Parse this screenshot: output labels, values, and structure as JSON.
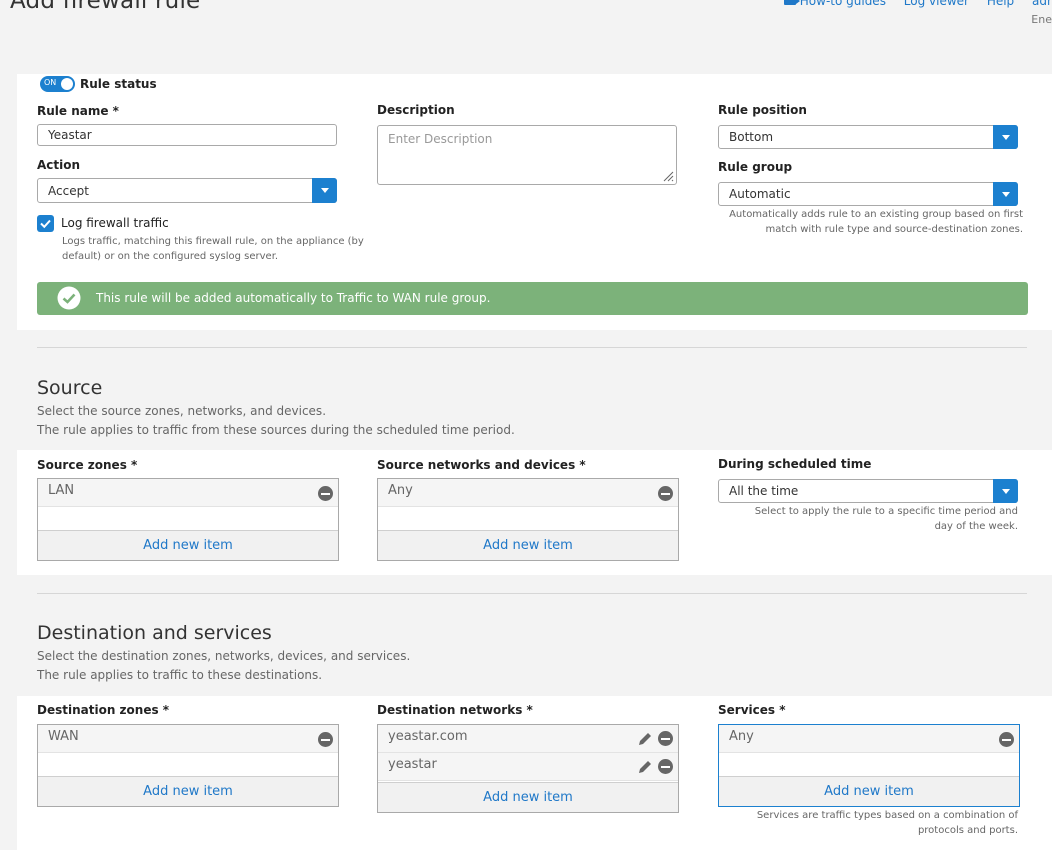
{
  "page": {
    "title": "Add firewall rule"
  },
  "top_links": {
    "howto": "How-to guides",
    "log_viewer": "Log viewer",
    "help": "Help",
    "admin": "admi",
    "admin_sub": "Ene"
  },
  "rule_status": {
    "toggle": "ON",
    "label": "Rule status"
  },
  "rule_name": {
    "label": "Rule name *",
    "value": "Yeastar"
  },
  "description": {
    "label": "Description",
    "placeholder": "Enter Description"
  },
  "rule_position": {
    "label": "Rule position",
    "value": "Bottom"
  },
  "action": {
    "label": "Action",
    "value": "Accept"
  },
  "rule_group": {
    "label": "Rule group",
    "value": "Automatic",
    "help_line1": "Automatically adds rule to an existing group based on first",
    "help_line2": "match with rule type and source-destination zones."
  },
  "log_traffic": {
    "label": "Log firewall traffic",
    "help_line1": "Logs traffic, matching this firewall rule, on the appliance (by",
    "help_line2": "default) or on the configured syslog server."
  },
  "notice": {
    "text": "This rule will be added automatically to Traffic to WAN rule group.",
    "color": "#7cb27a"
  },
  "source": {
    "title": "Source",
    "desc1": "Select the source zones, networks, and devices.",
    "desc2": "The rule applies to traffic from these sources during the scheduled time period.",
    "zones": {
      "label": "Source zones *",
      "items": [
        "LAN"
      ],
      "add": "Add new item"
    },
    "networks": {
      "label": "Source networks and devices *",
      "items": [
        "Any"
      ],
      "add": "Add new item"
    },
    "schedule": {
      "label": "During scheduled time",
      "value": "All the time",
      "help_line1": "Select to apply the rule to a specific time period and",
      "help_line2": "day of the week."
    }
  },
  "destination": {
    "title": "Destination and services",
    "desc1": "Select the destination zones, networks, devices, and services.",
    "desc2": "The rule applies to traffic to these destinations.",
    "zones": {
      "label": "Destination zones *",
      "items": [
        "WAN"
      ],
      "add": "Add new item"
    },
    "networks": {
      "label": "Destination networks *",
      "items": [
        "yeastar.com",
        "yeastar"
      ],
      "add": "Add new item"
    },
    "services": {
      "label": "Services *",
      "items": [
        "Any"
      ],
      "add": "Add new item",
      "help_line1": "Services are traffic types based on a combination of",
      "help_line2": "protocols and ports."
    }
  },
  "colors": {
    "accent": "#1c80cf",
    "link": "#1f78c8",
    "success": "#7cb27a"
  }
}
